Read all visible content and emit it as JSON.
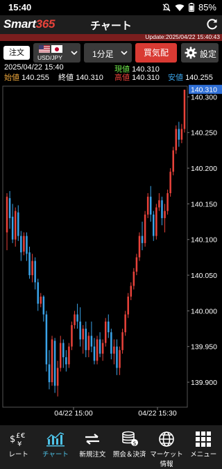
{
  "status": {
    "time": "15:40",
    "battery": "85%"
  },
  "header": {
    "logo_text": "Smart",
    "logo_num": "365",
    "title": "チャート"
  },
  "update": "Update:2025/04/22 15:40:43",
  "toolbar": {
    "order_label": "注文",
    "pair_label": "USD/JPY",
    "timeframe_label": "1分足",
    "buysell_label": "買気配",
    "settings_label": "設定"
  },
  "info": {
    "datetime": "2025/04/22 15:40",
    "open_label": "始値",
    "open_value": "140.255",
    "close_label": "終値",
    "close_value": "140.310",
    "current_label": "現値",
    "current_value": "140.310",
    "high_label": "高値",
    "high_value": "140.310",
    "low_label": "安値",
    "low_value": "140.255"
  },
  "chart_data": {
    "type": "candlestick",
    "y_ticks": [
      "140.300",
      "140.250",
      "140.200",
      "140.150",
      "140.100",
      "140.050",
      "140.000",
      "139.950",
      "139.900"
    ],
    "ylim": [
      139.865,
      140.315
    ],
    "x_ticks": [
      "04/22 15:00",
      "04/22 15:30"
    ],
    "current_price": "140.310",
    "up_color": "#e8423a",
    "down_color": "#3aa3e8",
    "candles": [
      [
        140.11,
        140.165,
        140.16,
        140.085
      ],
      [
        140.158,
        140.168,
        140.13,
        140.115
      ],
      [
        140.132,
        140.15,
        140.1,
        140.095
      ],
      [
        140.1,
        140.145,
        140.14,
        140.09
      ],
      [
        140.138,
        140.148,
        140.105,
        140.098
      ],
      [
        140.105,
        140.112,
        140.082,
        140.07
      ],
      [
        140.083,
        140.11,
        140.105,
        140.078
      ],
      [
        140.105,
        140.11,
        140.08,
        140.07
      ],
      [
        140.082,
        140.09,
        140.05,
        140.045
      ],
      [
        140.05,
        140.08,
        140.07,
        140.04
      ],
      [
        140.07,
        140.075,
        140.04,
        140.03
      ],
      [
        140.04,
        140.045,
        140.01,
        140.0
      ],
      [
        140.01,
        140.025,
        140.02,
        140.005
      ],
      [
        140.02,
        140.022,
        139.995,
        139.985
      ],
      [
        139.995,
        140.0,
        139.925,
        139.915
      ],
      [
        139.925,
        139.945,
        139.9,
        139.89
      ],
      [
        139.9,
        139.965,
        139.96,
        139.895
      ],
      [
        139.958,
        139.962,
        139.895,
        139.885
      ],
      [
        139.895,
        139.93,
        139.92,
        139.88
      ],
      [
        139.92,
        139.965,
        139.955,
        139.915
      ],
      [
        139.955,
        139.96,
        139.935,
        139.92
      ],
      [
        139.935,
        139.945,
        139.925,
        139.915
      ],
      [
        139.925,
        139.955,
        139.95,
        139.92
      ],
      [
        139.95,
        139.985,
        139.98,
        139.945
      ],
      [
        139.98,
        140.0,
        139.995,
        139.975
      ],
      [
        139.995,
        140.01,
        139.985,
        139.975
      ],
      [
        139.985,
        140.005,
        139.96,
        139.95
      ],
      [
        139.96,
        139.98,
        139.975,
        139.94
      ],
      [
        139.975,
        139.985,
        139.945,
        139.935
      ],
      [
        139.945,
        139.97,
        139.965,
        139.935
      ],
      [
        139.965,
        139.985,
        139.95,
        139.942
      ],
      [
        139.95,
        139.962,
        139.93,
        139.925
      ],
      [
        139.93,
        139.965,
        139.96,
        139.925
      ],
      [
        139.96,
        139.97,
        139.94,
        139.935
      ],
      [
        139.94,
        139.96,
        139.955,
        139.93
      ],
      [
        139.955,
        139.99,
        139.985,
        139.95
      ],
      [
        139.985,
        139.995,
        139.97,
        139.962
      ],
      [
        139.97,
        139.975,
        139.94,
        139.932
      ],
      [
        139.94,
        139.96,
        139.95,
        139.925
      ],
      [
        139.95,
        139.96,
        139.92,
        139.91
      ],
      [
        139.92,
        139.95,
        139.945,
        139.91
      ],
      [
        139.945,
        139.975,
        139.97,
        139.94
      ],
      [
        139.97,
        140.0,
        139.995,
        139.965
      ],
      [
        139.995,
        140.025,
        140.02,
        139.99
      ],
      [
        140.02,
        140.04,
        140.035,
        140.015
      ],
      [
        140.035,
        140.06,
        140.055,
        140.03
      ],
      [
        140.055,
        140.08,
        140.075,
        140.05
      ],
      [
        140.075,
        140.11,
        140.105,
        140.07
      ],
      [
        140.105,
        140.125,
        140.095,
        140.085
      ],
      [
        140.095,
        140.14,
        140.135,
        140.09
      ],
      [
        140.135,
        140.165,
        140.16,
        140.13
      ],
      [
        140.16,
        140.175,
        140.135,
        140.125
      ],
      [
        140.135,
        140.14,
        140.105,
        140.098
      ],
      [
        140.105,
        140.15,
        140.145,
        140.1
      ],
      [
        140.145,
        140.165,
        140.155,
        140.14
      ],
      [
        140.155,
        140.16,
        140.13,
        140.12
      ],
      [
        140.13,
        140.15,
        140.14,
        140.11
      ],
      [
        140.14,
        140.17,
        140.165,
        140.135
      ],
      [
        140.165,
        140.2,
        140.195,
        140.16
      ],
      [
        140.195,
        140.23,
        140.225,
        140.19
      ],
      [
        140.225,
        140.26,
        140.255,
        140.22
      ],
      [
        140.255,
        140.265,
        140.24,
        140.23
      ],
      [
        140.24,
        140.262,
        140.255,
        140.235
      ],
      [
        140.255,
        140.31,
        140.31,
        140.25
      ]
    ]
  },
  "nav": [
    {
      "label": "レート",
      "icon": "currency-icon"
    },
    {
      "label": "チャート",
      "icon": "chart-icon"
    },
    {
      "label": "新規注文",
      "icon": "arrows-icon"
    },
    {
      "label": "照会＆決済",
      "icon": "coins-icon"
    },
    {
      "label": "マーケット情報",
      "icon": "globe-icon"
    },
    {
      "label": "メニュー",
      "icon": "grid-icon"
    }
  ]
}
